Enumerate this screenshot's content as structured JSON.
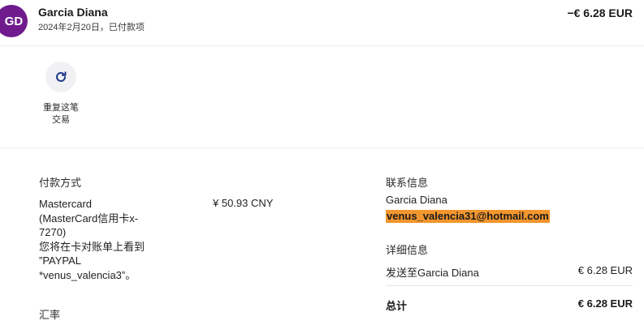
{
  "header": {
    "avatar_initials": "GD",
    "avatar_color": "#6f1b8e",
    "name": "Garcia Diana",
    "subtitle": "2024年2月20日，已付款项",
    "amount": "−€ 6.28 EUR"
  },
  "repeat": {
    "icon": "refresh-icon",
    "label_line1": "重复这笔",
    "label_line2": "交易"
  },
  "payment": {
    "title": "付款方式",
    "lines": [
      "Mastercard",
      "(MasterCard信用卡x-",
      "7270)",
      "您将在卡对账单上看到",
      "”PAYPAL",
      "*venus_valencia3”。"
    ],
    "amount": "¥ 50.93 CNY",
    "rate_title": "汇率"
  },
  "contact": {
    "title": "联系信息",
    "name": "Garcia Diana",
    "email": "venus_valencia31@hotmail.com",
    "email_highlight_color": "#f2962e"
  },
  "details": {
    "title": "详细信息",
    "ship_label": "发送至Garcia Diana",
    "ship_amount": "€ 6.28 EUR",
    "total_label": "总计",
    "total_amount": "€ 6.28 EUR"
  }
}
